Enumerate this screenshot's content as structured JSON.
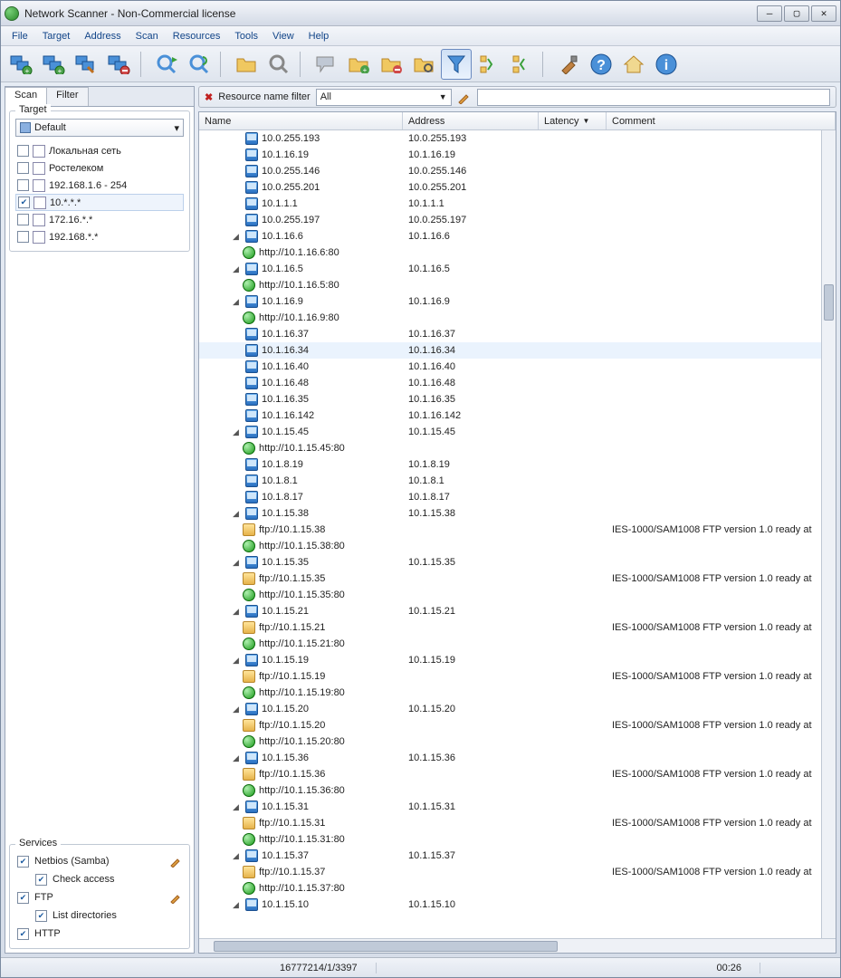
{
  "window": {
    "title": "Network Scanner - Non-Commercial license"
  },
  "menu": [
    "File",
    "Target",
    "Address",
    "Scan",
    "Resources",
    "Tools",
    "View",
    "Help"
  ],
  "tabs": {
    "scan": "Scan",
    "filter": "Filter"
  },
  "target_group": {
    "legend": "Target",
    "combo": "Default",
    "items": [
      {
        "checked": false,
        "label": "Локальная сеть"
      },
      {
        "checked": false,
        "label": "Ростелеком"
      },
      {
        "checked": false,
        "label": "192.168.1.6 - 254"
      },
      {
        "checked": true,
        "label": "10.*.*.*",
        "selected": true
      },
      {
        "checked": false,
        "label": "172.16.*.*"
      },
      {
        "checked": false,
        "label": "192.168.*.*"
      }
    ]
  },
  "services_group": {
    "legend": "Services",
    "items": [
      {
        "checked": true,
        "label": "Netbios (Samba)",
        "editicon": true
      },
      {
        "checked": true,
        "label": "Check access",
        "sub": true
      },
      {
        "checked": true,
        "label": "FTP",
        "editicon": true
      },
      {
        "checked": true,
        "label": "List directories",
        "sub": true
      },
      {
        "checked": true,
        "label": "HTTP"
      }
    ]
  },
  "filterbar": {
    "label": "Resource name filter",
    "combo": "All"
  },
  "grid": {
    "headers": {
      "name": "Name",
      "address": "Address",
      "latency": "Latency",
      "comment": "Comment"
    },
    "rows": [
      {
        "indent": 1,
        "icon": "monitor",
        "name": "10.0.255.193",
        "addr": "10.0.255.193"
      },
      {
        "indent": 1,
        "icon": "monitor",
        "name": "10.1.16.19",
        "addr": "10.1.16.19"
      },
      {
        "indent": 1,
        "icon": "monitor",
        "name": "10.0.255.146",
        "addr": "10.0.255.146"
      },
      {
        "indent": 1,
        "icon": "monitor",
        "name": "10.0.255.201",
        "addr": "10.0.255.201"
      },
      {
        "indent": 1,
        "icon": "monitor",
        "name": "10.1.1.1",
        "addr": "10.1.1.1"
      },
      {
        "indent": 1,
        "icon": "monitor",
        "name": "10.0.255.197",
        "addr": "10.0.255.197"
      },
      {
        "indent": 1,
        "icon": "monitor",
        "name": "10.1.16.6",
        "addr": "10.1.16.6",
        "expand": "open"
      },
      {
        "indent": 2,
        "icon": "globe",
        "name": "http://10.1.16.6:80"
      },
      {
        "indent": 1,
        "icon": "monitor",
        "name": "10.1.16.5",
        "addr": "10.1.16.5",
        "expand": "open"
      },
      {
        "indent": 2,
        "icon": "globe",
        "name": "http://10.1.16.5:80"
      },
      {
        "indent": 1,
        "icon": "monitor",
        "name": "10.1.16.9",
        "addr": "10.1.16.9",
        "expand": "open"
      },
      {
        "indent": 2,
        "icon": "globe",
        "name": "http://10.1.16.9:80"
      },
      {
        "indent": 1,
        "icon": "monitor",
        "name": "10.1.16.37",
        "addr": "10.1.16.37"
      },
      {
        "indent": 1,
        "icon": "monitor",
        "name": "10.1.16.34",
        "addr": "10.1.16.34",
        "hover": true
      },
      {
        "indent": 1,
        "icon": "monitor",
        "name": "10.1.16.40",
        "addr": "10.1.16.40"
      },
      {
        "indent": 1,
        "icon": "monitor",
        "name": "10.1.16.48",
        "addr": "10.1.16.48"
      },
      {
        "indent": 1,
        "icon": "monitor",
        "name": "10.1.16.35",
        "addr": "10.1.16.35"
      },
      {
        "indent": 1,
        "icon": "monitor",
        "name": "10.1.16.142",
        "addr": "10.1.16.142"
      },
      {
        "indent": 1,
        "icon": "monitor",
        "name": "10.1.15.45",
        "addr": "10.1.15.45",
        "expand": "open"
      },
      {
        "indent": 2,
        "icon": "globe",
        "name": "http://10.1.15.45:80"
      },
      {
        "indent": 1,
        "icon": "monitor",
        "name": "10.1.8.19",
        "addr": "10.1.8.19"
      },
      {
        "indent": 1,
        "icon": "monitor",
        "name": "10.1.8.1",
        "addr": "10.1.8.1"
      },
      {
        "indent": 1,
        "icon": "monitor",
        "name": "10.1.8.17",
        "addr": "10.1.8.17"
      },
      {
        "indent": 1,
        "icon": "monitor",
        "name": "10.1.15.38",
        "addr": "10.1.15.38",
        "expand": "open"
      },
      {
        "indent": 2,
        "icon": "folder",
        "name": "ftp://10.1.15.38",
        "comment": "IES-1000/SAM1008 FTP version 1.0 ready at"
      },
      {
        "indent": 2,
        "icon": "globe",
        "name": "http://10.1.15.38:80"
      },
      {
        "indent": 1,
        "icon": "monitor",
        "name": "10.1.15.35",
        "addr": "10.1.15.35",
        "expand": "open"
      },
      {
        "indent": 2,
        "icon": "folder",
        "name": "ftp://10.1.15.35",
        "comment": "IES-1000/SAM1008 FTP version 1.0 ready at"
      },
      {
        "indent": 2,
        "icon": "globe",
        "name": "http://10.1.15.35:80"
      },
      {
        "indent": 1,
        "icon": "monitor",
        "name": "10.1.15.21",
        "addr": "10.1.15.21",
        "expand": "open"
      },
      {
        "indent": 2,
        "icon": "folder",
        "name": "ftp://10.1.15.21",
        "comment": "IES-1000/SAM1008 FTP version 1.0 ready at"
      },
      {
        "indent": 2,
        "icon": "globe",
        "name": "http://10.1.15.21:80"
      },
      {
        "indent": 1,
        "icon": "monitor",
        "name": "10.1.15.19",
        "addr": "10.1.15.19",
        "expand": "open"
      },
      {
        "indent": 2,
        "icon": "folder",
        "name": "ftp://10.1.15.19",
        "comment": "IES-1000/SAM1008 FTP version 1.0 ready at"
      },
      {
        "indent": 2,
        "icon": "globe",
        "name": "http://10.1.15.19:80"
      },
      {
        "indent": 1,
        "icon": "monitor",
        "name": "10.1.15.20",
        "addr": "10.1.15.20",
        "expand": "open"
      },
      {
        "indent": 2,
        "icon": "folder",
        "name": "ftp://10.1.15.20",
        "comment": "IES-1000/SAM1008 FTP version 1.0 ready at"
      },
      {
        "indent": 2,
        "icon": "globe",
        "name": "http://10.1.15.20:80"
      },
      {
        "indent": 1,
        "icon": "monitor",
        "name": "10.1.15.36",
        "addr": "10.1.15.36",
        "expand": "open"
      },
      {
        "indent": 2,
        "icon": "folder",
        "name": "ftp://10.1.15.36",
        "comment": "IES-1000/SAM1008 FTP version 1.0 ready at"
      },
      {
        "indent": 2,
        "icon": "globe",
        "name": "http://10.1.15.36:80"
      },
      {
        "indent": 1,
        "icon": "monitor",
        "name": "10.1.15.31",
        "addr": "10.1.15.31",
        "expand": "open"
      },
      {
        "indent": 2,
        "icon": "folder",
        "name": "ftp://10.1.15.31",
        "comment": "IES-1000/SAM1008 FTP version 1.0 ready at"
      },
      {
        "indent": 2,
        "icon": "globe",
        "name": "http://10.1.15.31:80"
      },
      {
        "indent": 1,
        "icon": "monitor",
        "name": "10.1.15.37",
        "addr": "10.1.15.37",
        "expand": "open"
      },
      {
        "indent": 2,
        "icon": "folder",
        "name": "ftp://10.1.15.37",
        "comment": "IES-1000/SAM1008 FTP version 1.0 ready at"
      },
      {
        "indent": 2,
        "icon": "globe",
        "name": "http://10.1.15.37:80"
      },
      {
        "indent": 1,
        "icon": "monitor",
        "name": "10.1.15.10",
        "addr": "10.1.15.10",
        "expand": "open"
      }
    ]
  },
  "status": {
    "counts": "16777214/1/3397",
    "time": "00:26"
  }
}
